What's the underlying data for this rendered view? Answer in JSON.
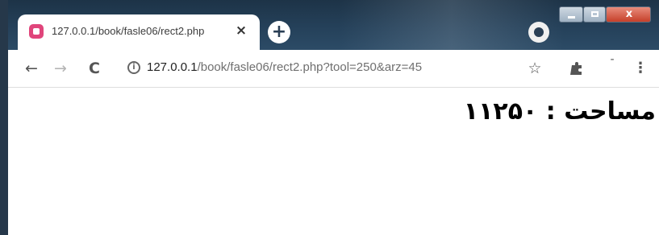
{
  "tab": {
    "title": "127.0.0.1/book/fasle06/rect2.php",
    "close_label": "×",
    "favicon": "page-favicon-icon"
  },
  "tabstrip": {
    "new_tab_label": "+"
  },
  "window_controls": {
    "close_label": "x"
  },
  "toolbar": {
    "back_label": "←",
    "forward_label": "→",
    "reload_label": "C",
    "info_label": "i",
    "bookmark_label": "☆",
    "menu_label": "⋮",
    "minus_label": "-"
  },
  "address_bar": {
    "host": "127.0.0.1",
    "path": "/book/fasle06/rect2.php?tool=250&arz=45"
  },
  "page": {
    "result_text": "مساحت : ۱۱۲۵۰"
  },
  "colors": {
    "favicon": "#e0457b",
    "tabstrip": "#25415a",
    "close_button": "#c6402a"
  }
}
